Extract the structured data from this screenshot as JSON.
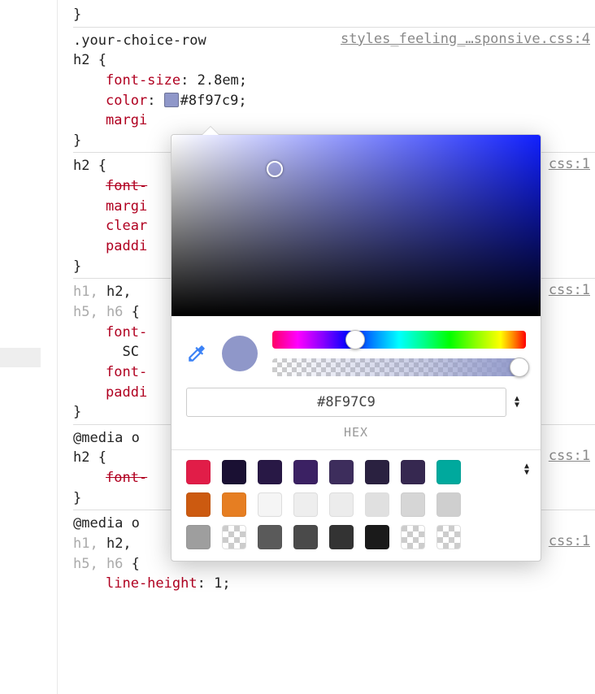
{
  "rule0": {
    "close": "}"
  },
  "rule1": {
    "selector": ".your-choice-row h2 {",
    "src": "styles_feeling_…sponsive.css:4",
    "p1": "font-size",
    "v1": "2.8em;",
    "p2": "color",
    "v2": "#8f97c9;",
    "swatch_color": "#8f97c9",
    "p3_line": "margi",
    "close": "}"
  },
  "rule2": {
    "selector": "h2 {",
    "src": "css:1",
    "p1": "font-",
    "p2": "margi",
    "p3": "clear",
    "p4": "paddi",
    "close": "}"
  },
  "rule3": {
    "selector_dim": "h1,",
    "selector1": " h2,",
    "selector_dim2": "h5, h6",
    "brace": " {",
    "src": "css:1",
    "p1_frag": "font-",
    "p1_sub": "  SC",
    "p2": "font-",
    "p3": "paddi",
    "close": "}"
  },
  "rule4": {
    "media": "@media o",
    "media_tail": ")",
    "selector": "h2 {",
    "src": "css:1",
    "p1": "font-",
    "close": "}"
  },
  "rule5": {
    "media": "@media o",
    "media_tail": ")",
    "selector_dim": "h1,",
    "selector1": " h2,",
    "selector_dim2": "h5, h6",
    "brace": " {",
    "src": "css:1",
    "p1": "line-height",
    "v1": "1;"
  },
  "picker": {
    "hex_value": "#8F97C9",
    "format_label": "HEX",
    "preview_color": "#8f97c9",
    "palette": {
      "row1": [
        "#e11d48",
        "#1a1033",
        "#281845",
        "#3b2163",
        "#3d2d5c",
        "#2a2140",
        "#362850",
        "#00a99d"
      ],
      "row2": [
        "#cc5a10",
        "#e67e22"
      ],
      "row2_light": [
        "#f5f5f5",
        "#eeeeee",
        "#ececec",
        "#e0e0e0",
        "#d6d6d6",
        "#cfcfcf"
      ],
      "row3": [
        "#9e9e9e",
        "checker",
        "#5a5a5a",
        "#4a4a4a",
        "#333333",
        "#1a1a1a",
        "checker",
        "checker"
      ]
    }
  }
}
